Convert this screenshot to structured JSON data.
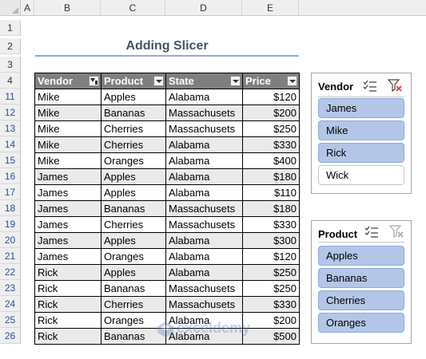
{
  "columns": [
    "A",
    "B",
    "C",
    "D",
    "E"
  ],
  "rows": {
    "top": [
      "1",
      "2",
      "3",
      "4"
    ],
    "data": [
      "11",
      "12",
      "13",
      "14",
      "15",
      "16",
      "17",
      "18",
      "19",
      "20",
      "21",
      "22",
      "23",
      "24",
      "25",
      "26"
    ]
  },
  "title": "Adding Slicer",
  "table": {
    "headers": [
      "Vendor",
      "Product",
      "State",
      "Price"
    ],
    "rows": [
      [
        "Mike",
        "Apples",
        "Alabama",
        "$120"
      ],
      [
        "Mike",
        "Bananas",
        "Massachusets",
        "$200"
      ],
      [
        "Mike",
        "Cherries",
        "Massachusets",
        "$250"
      ],
      [
        "Mike",
        "Cherries",
        "Alabama",
        "$330"
      ],
      [
        "Mike",
        "Oranges",
        "Alabama",
        "$400"
      ],
      [
        "James",
        "Apples",
        "Alabama",
        "$180"
      ],
      [
        "James",
        "Apples",
        "Alabama",
        "$110"
      ],
      [
        "James",
        "Bananas",
        "Massachusets",
        "$180"
      ],
      [
        "James",
        "Cherries",
        "Massachusets",
        "$330"
      ],
      [
        "James",
        "Apples",
        "Alabama",
        "$300"
      ],
      [
        "James",
        "Oranges",
        "Alabama",
        "$120"
      ],
      [
        "Rick",
        "Apples",
        "Alabama",
        "$250"
      ],
      [
        "Rick",
        "Bananas",
        "Massachusets",
        "$250"
      ],
      [
        "Rick",
        "Cherries",
        "Massachusets",
        "$330"
      ],
      [
        "Rick",
        "Oranges",
        "Alabama",
        "$200"
      ],
      [
        "Rick",
        "Bananas",
        "Alabama",
        "$500"
      ]
    ]
  },
  "slicers": {
    "vendor": {
      "title": "Vendor",
      "items": [
        {
          "label": "James",
          "selected": true
        },
        {
          "label": "Mike",
          "selected": true
        },
        {
          "label": "Rick",
          "selected": true
        },
        {
          "label": "Wick",
          "selected": false
        }
      ],
      "icons": [
        "multi-select-icon",
        "clear-filter-icon"
      ]
    },
    "product": {
      "title": "Product",
      "items": [
        {
          "label": "Apples",
          "selected": true
        },
        {
          "label": "Bananas",
          "selected": true
        },
        {
          "label": "Cherries",
          "selected": true
        },
        {
          "label": "Oranges",
          "selected": true
        }
      ],
      "icons": [
        "multi-select-icon",
        "clear-filter-icon"
      ]
    }
  },
  "watermark": "exceldemy",
  "colors": {
    "header_bg": "#7f7f7f",
    "band_bg": "#eaeaea",
    "slicer_selected": "#b4c6e7",
    "title_text": "#44546a",
    "row_number": "#2b4fa3",
    "clear_filter_red": "#e03a3a"
  }
}
